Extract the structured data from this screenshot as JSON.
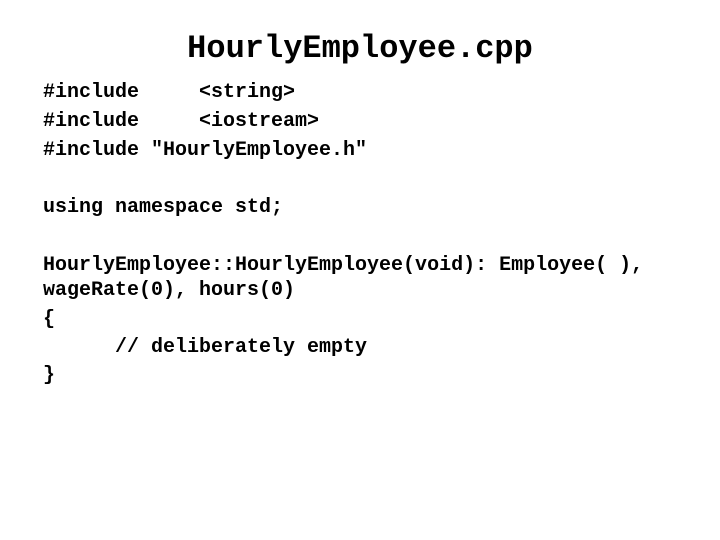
{
  "slide": {
    "title": "HourlyEmployee.cpp",
    "code_lines": [
      "#include     <string>",
      "#include     <iostream>",
      "#include \"HourlyEmployee.h\"",
      "using namespace std;",
      "HourlyEmployee::HourlyEmployee(void): Employee( ),",
      "wageRate(0), hours(0)",
      "{",
      "      // deliberately empty",
      "}"
    ]
  }
}
